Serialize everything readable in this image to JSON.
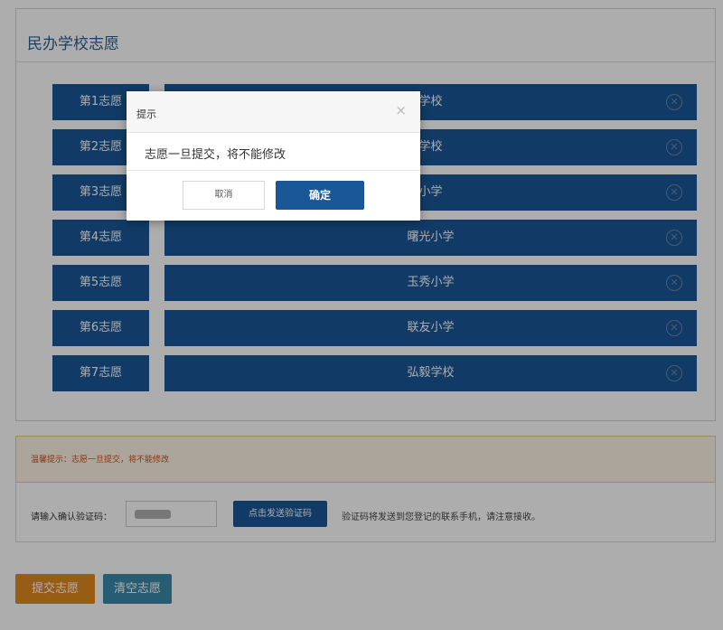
{
  "panel": {
    "title": "民办学校志愿"
  },
  "preferences": [
    {
      "label": "第1志愿",
      "school": "学校"
    },
    {
      "label": "第2志愿",
      "school": "学校"
    },
    {
      "label": "第3志愿",
      "school": "小学"
    },
    {
      "label": "第4志愿",
      "school": "曙光小学"
    },
    {
      "label": "第5志愿",
      "school": "玉秀小学"
    },
    {
      "label": "第6志愿",
      "school": "联友小学"
    },
    {
      "label": "第7志愿",
      "school": "弘毅学校"
    }
  ],
  "remove_icon": "close-circle-icon",
  "tip": {
    "text": "温馨提示：志愿一旦提交，将不能修改"
  },
  "code": {
    "label": "请输入确认验证码：",
    "send_button": "点击发送验证码",
    "note": "验证码将发送到您登记的联系手机，请注意接收。"
  },
  "actions": {
    "submit": "提交志愿",
    "clear": "清空志愿"
  },
  "modal": {
    "title": "提示",
    "close_glyph": "×",
    "message": "志愿一旦提交，将不能修改",
    "cancel": "取消",
    "confirm": "确定"
  },
  "colors": {
    "primary": "#1a5797",
    "submit": "#e08a1e",
    "clear": "#3a8aa8",
    "warning_text": "#d24a12"
  }
}
